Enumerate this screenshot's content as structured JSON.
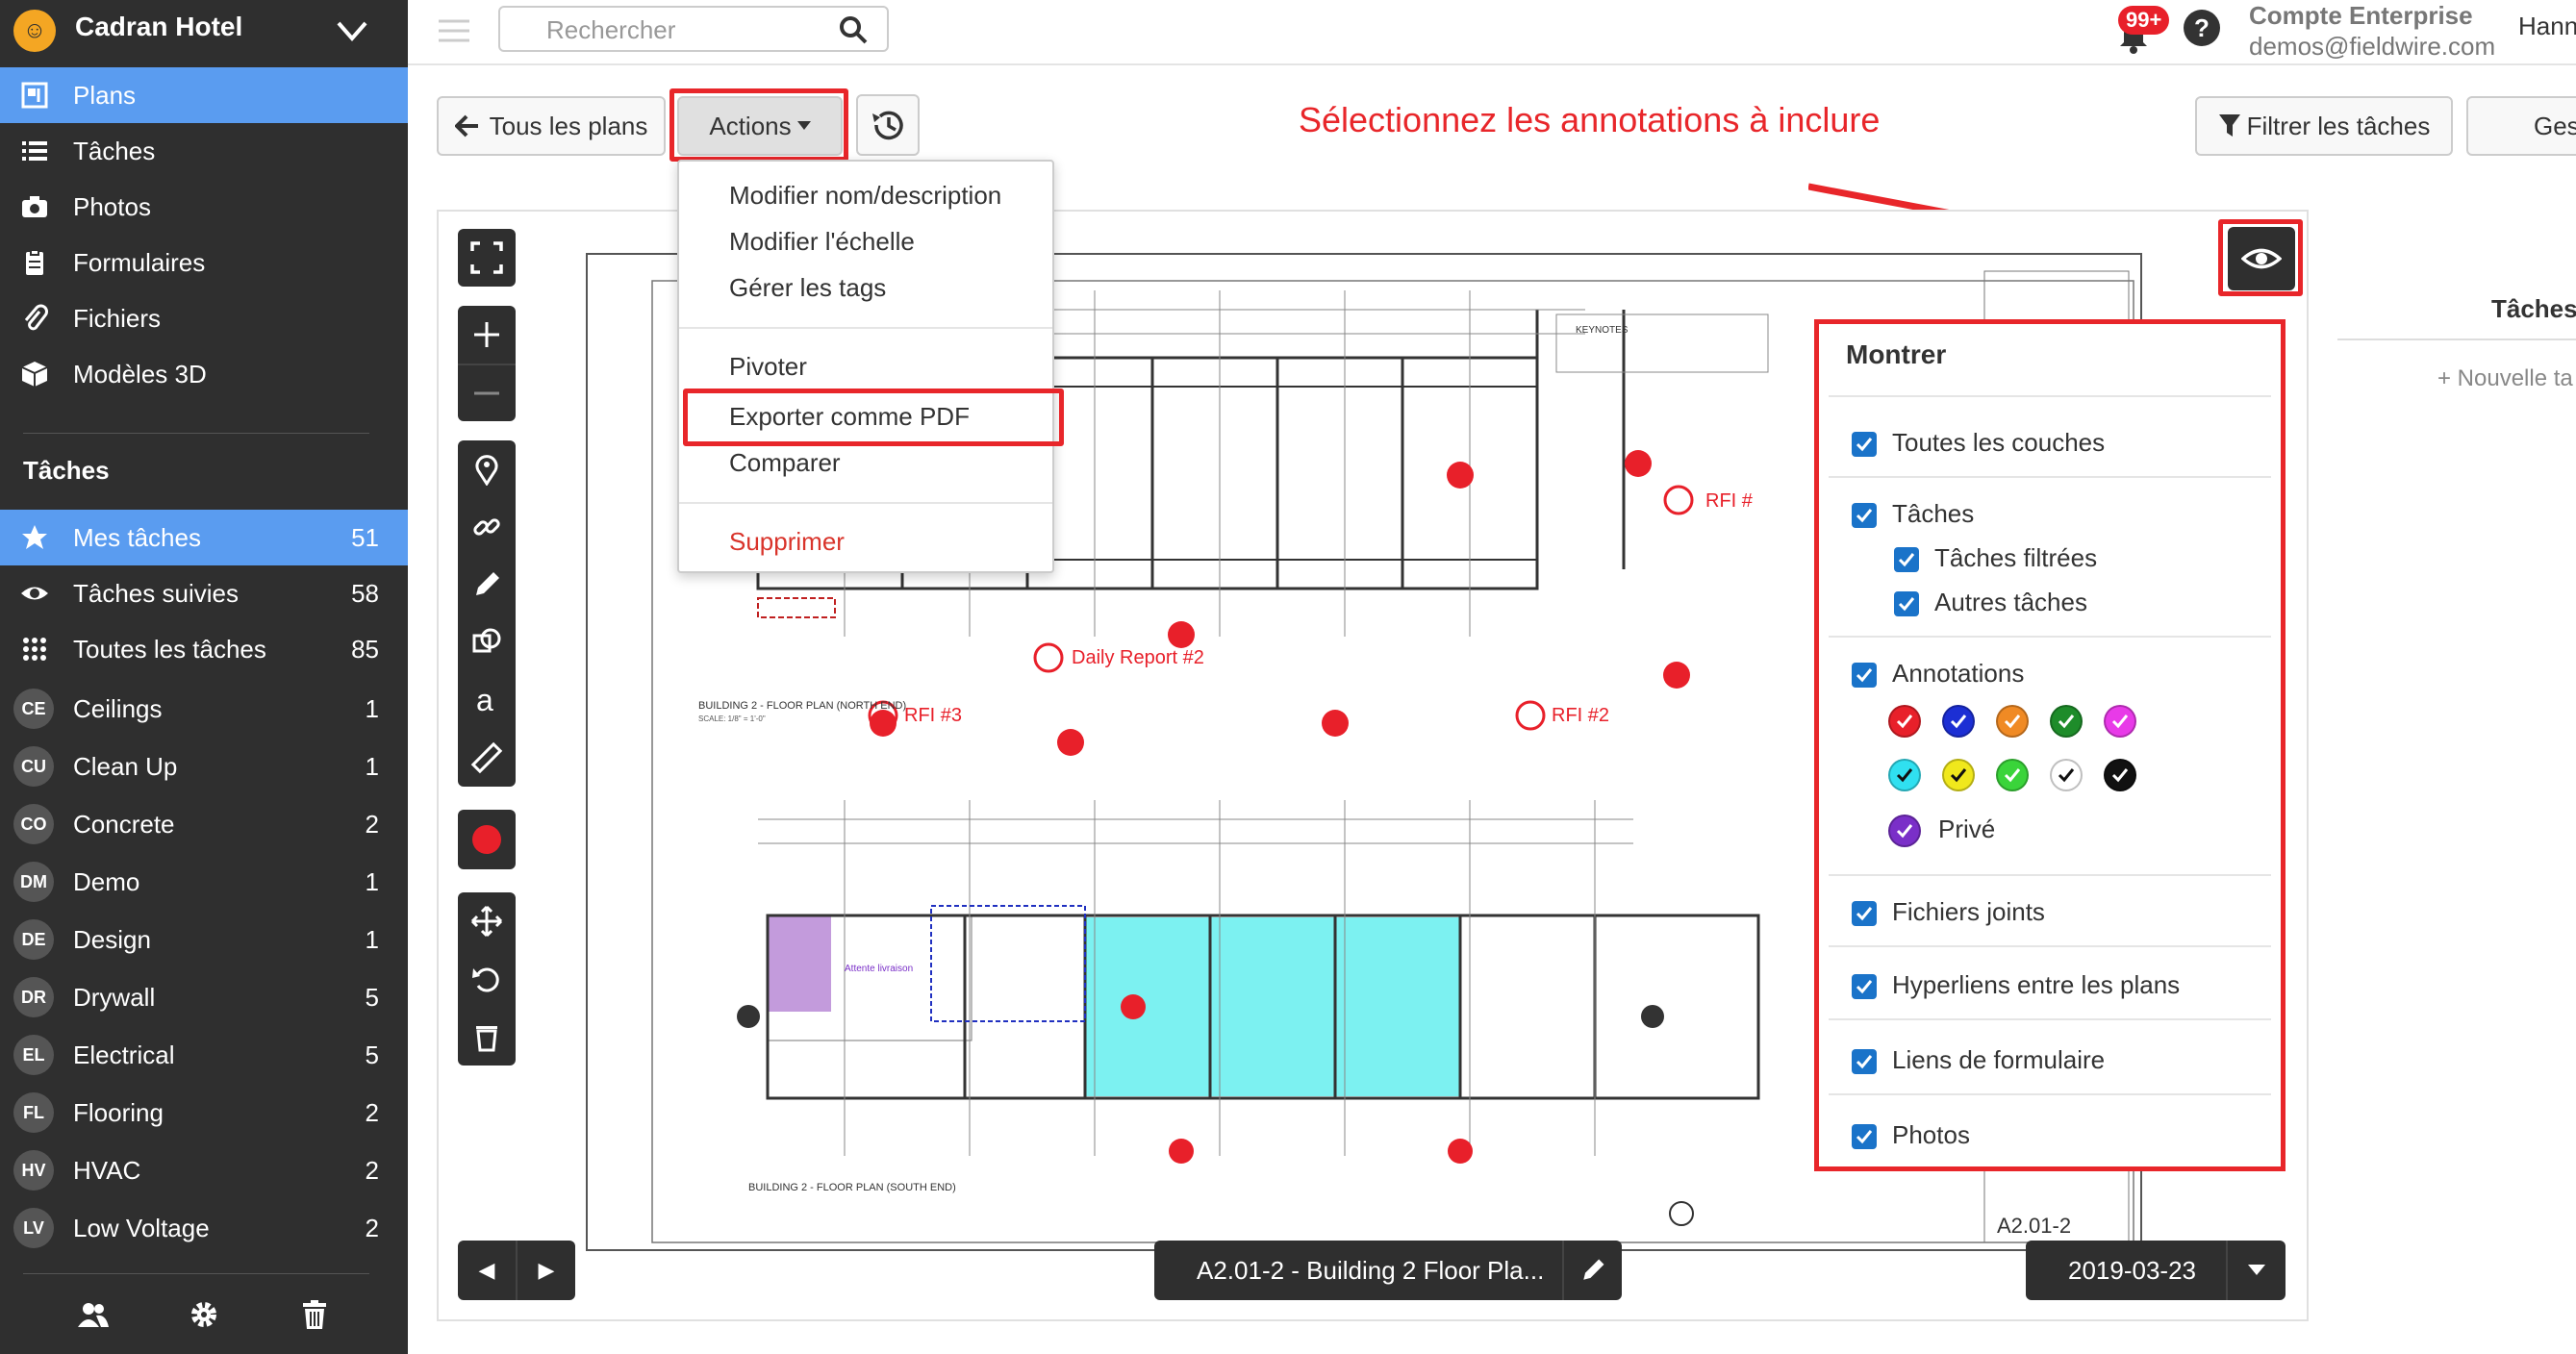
{
  "sidebar": {
    "project": "Cadran Hotel",
    "nav": [
      {
        "label": "Plans",
        "icon": "plans-icon"
      },
      {
        "label": "Tâches",
        "icon": "list-icon"
      },
      {
        "label": "Photos",
        "icon": "camera-icon"
      },
      {
        "label": "Formulaires",
        "icon": "form-icon"
      },
      {
        "label": "Fichiers",
        "icon": "paperclip-icon"
      },
      {
        "label": "Modèles 3D",
        "icon": "cube-icon"
      }
    ],
    "tasks_section": "Tâches",
    "task_filters": [
      {
        "label": "Mes tâches",
        "count": "51",
        "icon": "star-icon"
      },
      {
        "label": "Tâches suivies",
        "count": "58",
        "icon": "eye-icon"
      },
      {
        "label": "Toutes les tâches",
        "count": "85",
        "icon": "grid-icon"
      }
    ],
    "categories": [
      {
        "badge": "CE",
        "label": "Ceilings",
        "count": "1"
      },
      {
        "badge": "CU",
        "label": "Clean Up",
        "count": "1"
      },
      {
        "badge": "CO",
        "label": "Concrete",
        "count": "2"
      },
      {
        "badge": "DM",
        "label": "Demo",
        "count": "1"
      },
      {
        "badge": "DE",
        "label": "Design",
        "count": "1"
      },
      {
        "badge": "DR",
        "label": "Drywall",
        "count": "5"
      },
      {
        "badge": "EL",
        "label": "Electrical",
        "count": "5"
      },
      {
        "badge": "FL",
        "label": "Flooring",
        "count": "2"
      },
      {
        "badge": "HV",
        "label": "HVAC",
        "count": "2"
      },
      {
        "badge": "LV",
        "label": "Low Voltage",
        "count": "2"
      }
    ]
  },
  "topbar": {
    "search_placeholder": "Rechercher",
    "notifications": "99+",
    "help": "?",
    "account_name": "Compte Enterprise",
    "account_email": "demos@fieldwire.com",
    "user": "Hann"
  },
  "toolbar": {
    "back": "Tous les plans",
    "actions": "Actions",
    "filter_tasks": "Filtrer les tâches",
    "manage": "Gestion"
  },
  "annotation_hint": "Sélectionnez les annotations à inclure",
  "actions_menu": [
    "Modifier nom/description",
    "Modifier l'échelle",
    "Gérer les tags",
    "Pivoter",
    "Exporter comme PDF",
    "Comparer",
    "Supprimer"
  ],
  "show_panel": {
    "title": "Montrer",
    "all_layers": "Toutes les couches",
    "tasks": "Tâches",
    "filtered_tasks": "Tâches filtrées",
    "other_tasks": "Autres tâches",
    "annotations": "Annotations",
    "annotation_colors_row1": [
      "#e8202a",
      "#1c2fd4",
      "#f08a24",
      "#1e8c2a",
      "#e83ae8"
    ],
    "annotation_colors_row2": [
      "#30e0f0",
      "#f0e81c",
      "#3ad43a",
      "#ffffff",
      "#111111"
    ],
    "private_color": "#7a2fc8",
    "private": "Privé",
    "attachments": "Fichiers joints",
    "hyperlinks": "Hyperliens entre les plans",
    "form_links": "Liens de formulaire",
    "photos": "Photos"
  },
  "plan": {
    "sheet": "A2.01-2 - Building 2 Floor Pla...",
    "date": "2019-03-23",
    "sheet_number": "A2.01-2",
    "labels": {
      "rfi1": "RFI #",
      "rfi2": "RFI #2",
      "rfi3": "RFI #3",
      "daily": "Daily Report #2",
      "north": "BUILDING 2 - FLOOR PLAN (NORTH END)",
      "south": "BUILDING 2 - FLOOR PLAN (SOUTH END)",
      "keynotes": "KEYNOTES",
      "attente": "Attente livraison",
      "scale": "SCALE: 1/8\" = 1'-0\""
    }
  },
  "right_panel": {
    "tasks": "Tâches",
    "new": "+ Nouvelle ta"
  },
  "colors": {
    "sidebar": "#2f2f2f",
    "active": "#5a9cf0",
    "highlight": "#e8262a",
    "checkbox": "#1a73c9",
    "cyan_area": "#6ef0f0",
    "purple_area": "#b98ad6"
  }
}
